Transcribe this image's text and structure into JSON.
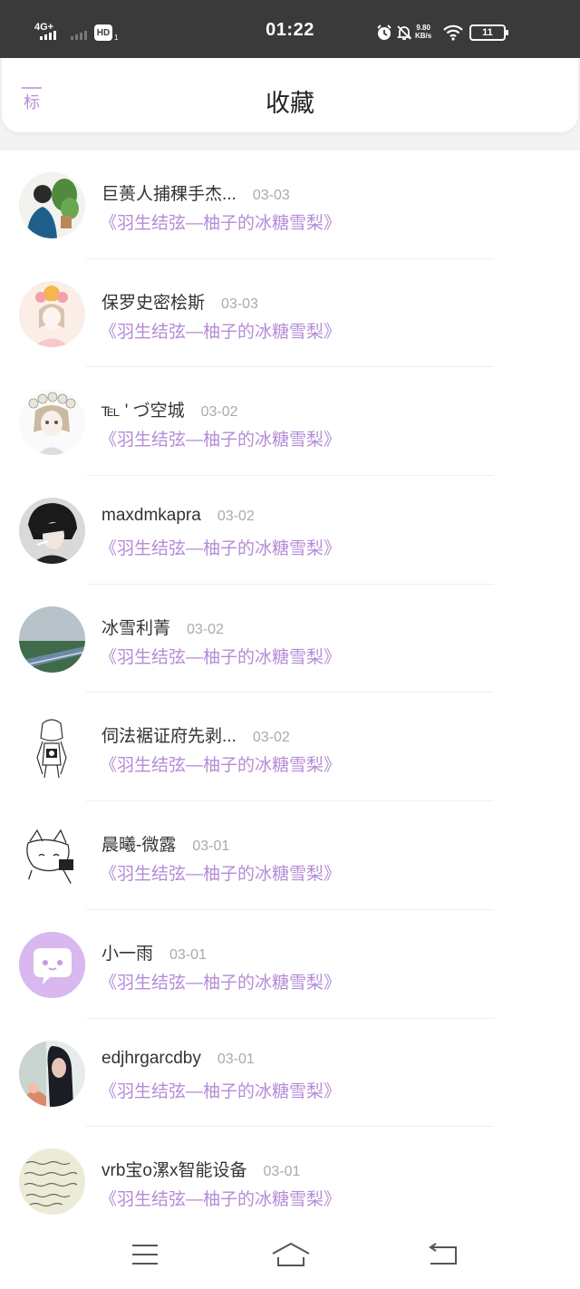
{
  "status_bar": {
    "network": "4G+",
    "hd_label": "HD",
    "hd_sub": "1",
    "time": "01:22",
    "speed_value": "9.80",
    "speed_unit": "KB/s",
    "battery": "11",
    "icons": [
      "signal-icon",
      "hd-icon",
      "alarm-icon",
      "mute-icon",
      "wifi-icon",
      "battery-icon"
    ]
  },
  "header": {
    "back_label": "标",
    "title": "收藏"
  },
  "colors": {
    "accent": "#b58bd6",
    "status_bar_bg": "#3a3a3a",
    "date_gray": "#aaaaaa"
  },
  "items": [
    {
      "name": "巨蒉人捕稞手杰...",
      "date": "03-03",
      "book": "《羽生结弦—柚子的冰糖雪梨》",
      "avatar": "avatar-girl-plant"
    },
    {
      "name": "保罗史密桧斯",
      "date": "03-03",
      "book": "《羽生结弦—柚子的冰糖雪梨》",
      "avatar": "avatar-anime-flower"
    },
    {
      "name": "℡ ' づ空城",
      "date": "03-02",
      "book": "《羽生结弦—柚子的冰糖雪梨》",
      "avatar": "avatar-girl-wreath"
    },
    {
      "name": "maxdmkapra",
      "date": "03-02",
      "book": "《羽生结弦—柚子的冰糖雪梨》",
      "avatar": "avatar-person-dark"
    },
    {
      "name": "冰雪利菁",
      "date": "03-02",
      "book": "《羽生结弦—柚子的冰糖雪梨》",
      "avatar": "avatar-landscape"
    },
    {
      "name": "伺法裾证府先剥...",
      "date": "03-02",
      "book": "《羽生结弦—柚子的冰糖雪梨》",
      "avatar": "avatar-sketch-girl"
    },
    {
      "name": "晨曦-微露",
      "date": "03-01",
      "book": "《羽生结弦—柚子的冰糖雪梨》",
      "avatar": "avatar-sketch-cat"
    },
    {
      "name": "小一雨",
      "date": "03-01",
      "book": "《羽生结弦—柚子的冰糖雪梨》",
      "avatar": "avatar-default-chat"
    },
    {
      "name": "edjhrgarcdby",
      "date": "03-01",
      "book": "《羽生结弦—柚子的冰糖雪梨》",
      "avatar": "avatar-photo-girl"
    },
    {
      "name": "vrb宝o漯x智能设备",
      "date": "03-01",
      "book": "《羽生结弦—柚子的冰糖雪梨》",
      "avatar": "avatar-handwriting"
    }
  ],
  "nav_bar": {
    "icons": [
      "menu-icon",
      "home-icon",
      "back-icon"
    ]
  }
}
